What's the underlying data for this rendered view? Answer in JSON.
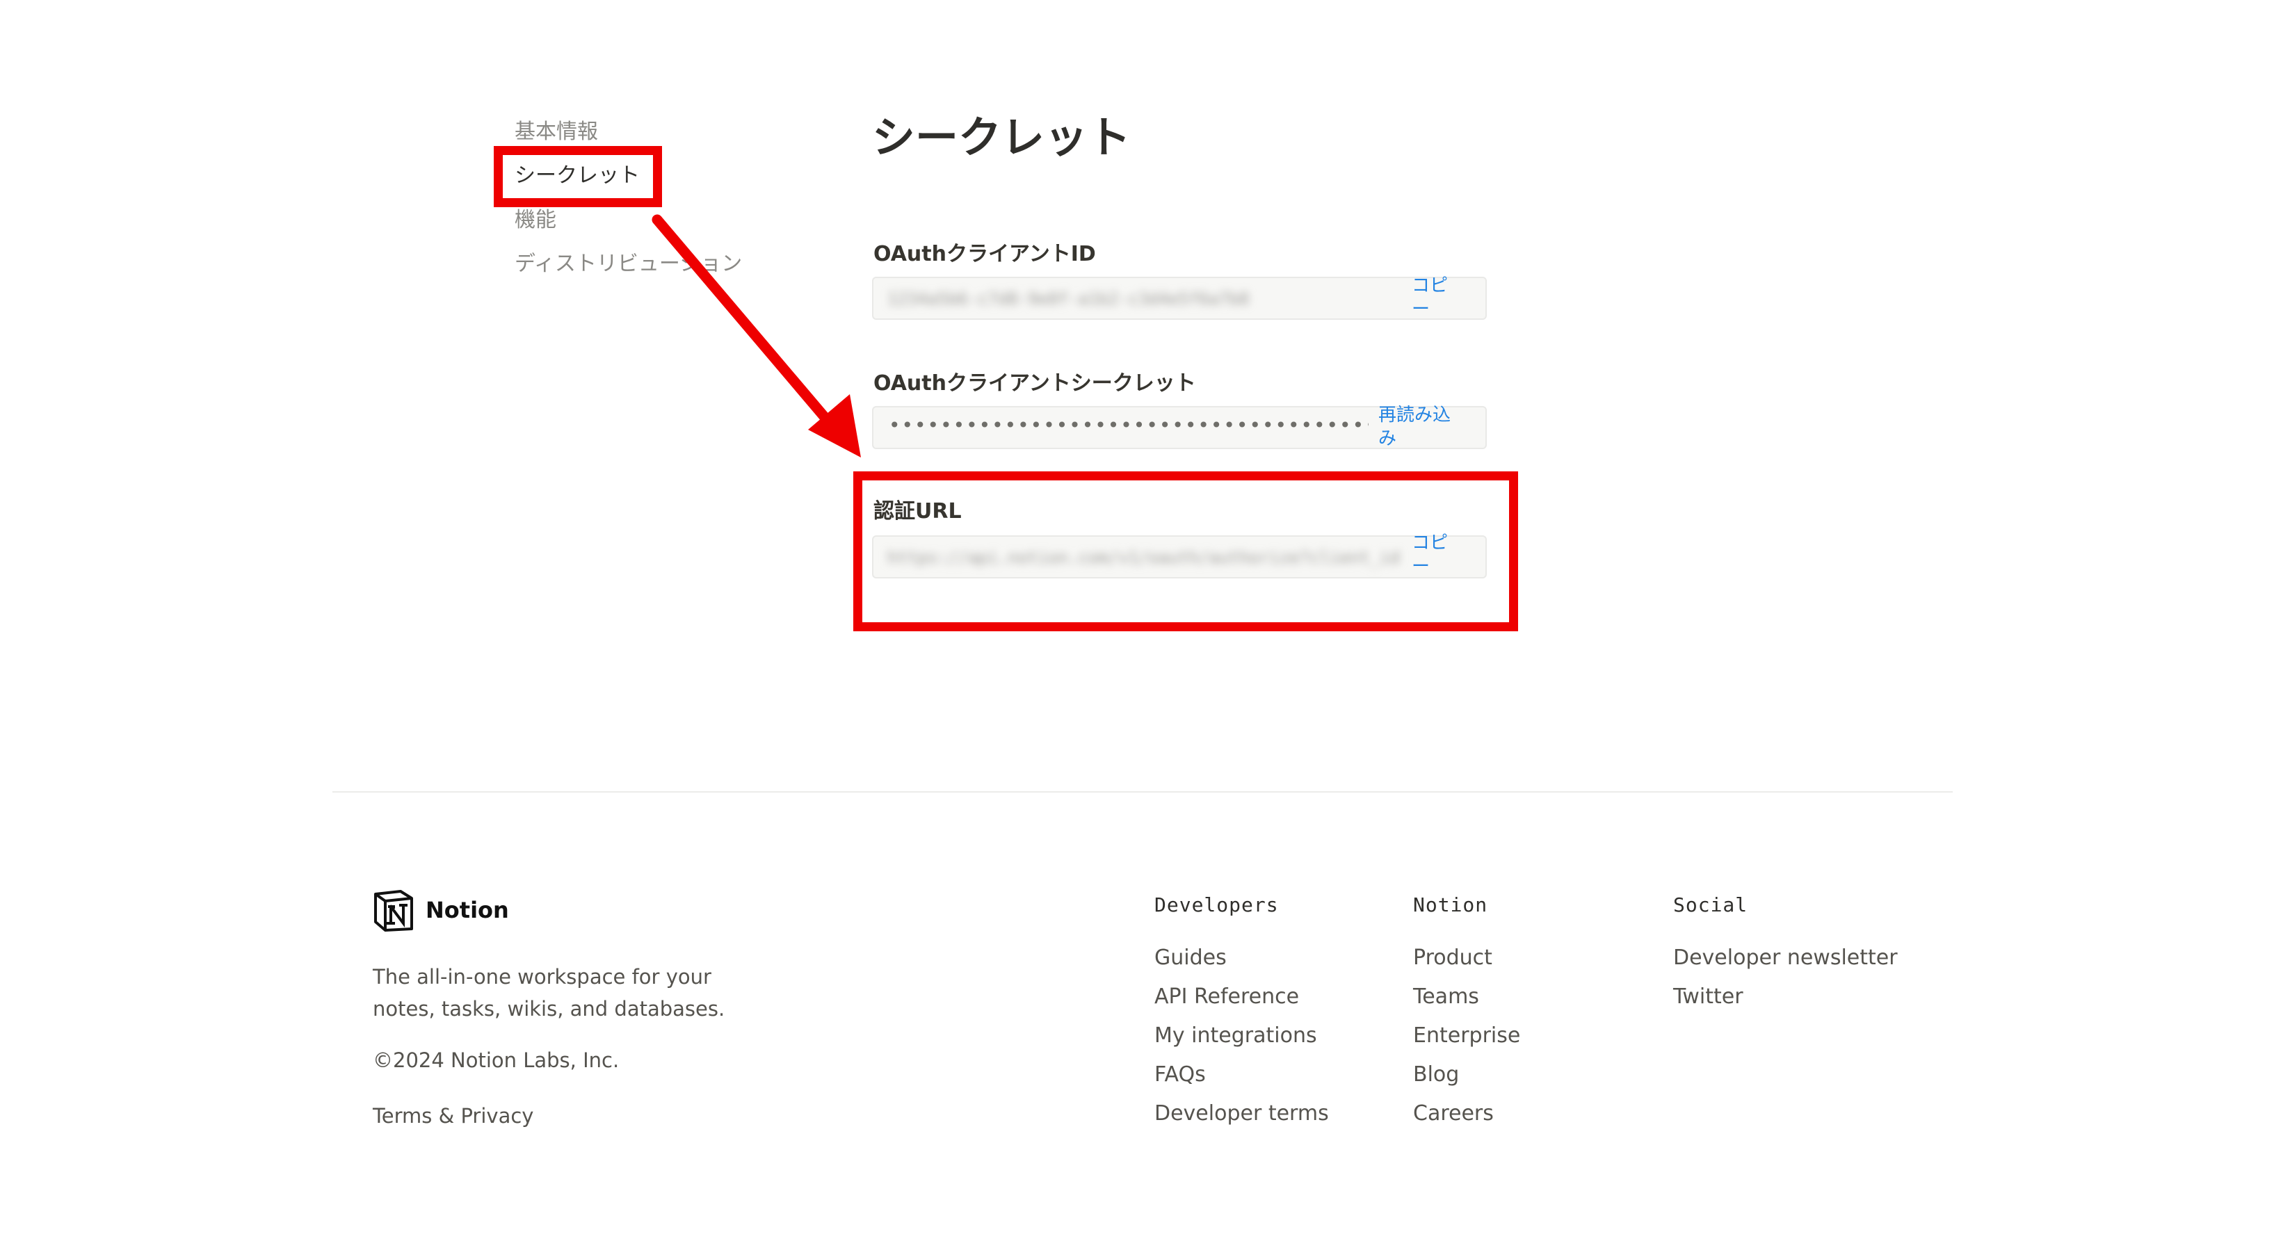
{
  "sidebar": {
    "items": [
      {
        "label": "基本情報"
      },
      {
        "label": "シークレット"
      },
      {
        "label": "機能"
      },
      {
        "label": "ディストリビューション"
      }
    ]
  },
  "main": {
    "title": "シークレット",
    "fields": [
      {
        "label": "OAuthクライアントID",
        "value": "1234a5b6-c7d8-9e0f-a1b2-c3d4e5f6a7b8",
        "action": "コピー"
      },
      {
        "label": "OAuthクライアントシークレット",
        "value": "••••••••••••••••••••••••••••••••••••••••",
        "action": "再読み込み"
      },
      {
        "label": "認証URL",
        "value": "https://api.notion.com/v1/oauth/authorize?client_id",
        "action": "コピー"
      }
    ]
  },
  "annotations": {
    "color": "#ee0000"
  },
  "footer": {
    "brand": "Notion",
    "tagline": "The all-in-one workspace for your notes, tasks, wikis, and databases.",
    "copyright": "©2024 Notion Labs, Inc.",
    "terms": "Terms & Privacy",
    "columns": [
      {
        "title": "Developers",
        "links": [
          "Guides",
          "API Reference",
          "My integrations",
          "FAQs",
          "Developer terms"
        ]
      },
      {
        "title": "Notion",
        "links": [
          "Product",
          "Teams",
          "Enterprise",
          "Blog",
          "Careers"
        ]
      },
      {
        "title": "Social",
        "links": [
          "Developer newsletter",
          "Twitter"
        ]
      }
    ]
  }
}
